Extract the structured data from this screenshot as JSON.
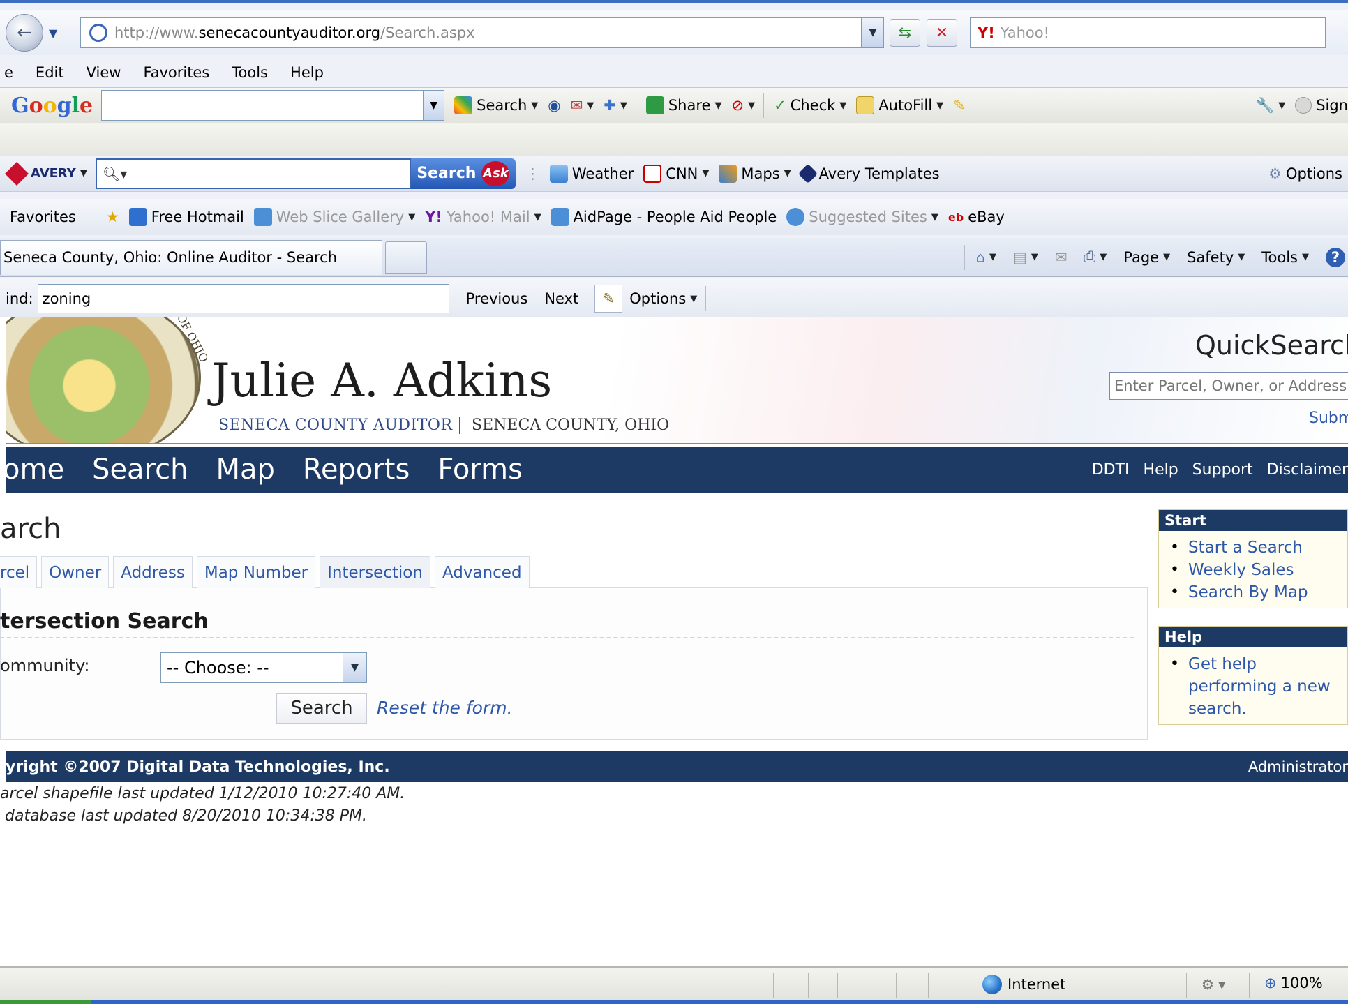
{
  "browser": {
    "address": {
      "host_prefix": "http://www.",
      "host": "senecacountyauditor.org",
      "path": "/Search.aspx"
    },
    "yahoo_search": {
      "brand": "Y!",
      "placeholder": "Yahoo!"
    },
    "menu": [
      "e",
      "Edit",
      "View",
      "Favorites",
      "Tools",
      "Help"
    ],
    "google_toolbar": {
      "logo": [
        "G",
        "o",
        "o",
        "g",
        "l",
        "e"
      ],
      "items": {
        "search": "Search",
        "share": "Share",
        "check": "Check",
        "autofill": "AutoFill",
        "sign": "Sign"
      }
    },
    "ask_toolbar": {
      "brand": "AVERY",
      "search_button": "Search",
      "ask_logo": "Ask",
      "items": {
        "weather": "Weather",
        "cnn": "CNN",
        "maps": "Maps",
        "avery_templates": "Avery Templates",
        "options": "Options"
      }
    },
    "favorites_bar": {
      "label": "Favorites",
      "items": {
        "hotmail": "Free Hotmail",
        "webslice": "Web Slice Gallery",
        "yahoo_mail": "Yahoo! Mail",
        "aidpage": "AidPage - People Aid People",
        "suggested": "Suggested Sites",
        "ebay": "eBay"
      }
    },
    "tab_title": "Seneca County, Ohio: Online Auditor - Search",
    "command_bar": {
      "page": "Page",
      "safety": "Safety",
      "tools": "Tools"
    },
    "find_bar": {
      "label": "ind:",
      "value": "zoning",
      "previous": "Previous",
      "next": "Next",
      "options": "Options"
    },
    "status": {
      "zone": "Internet",
      "zoom": "100%"
    }
  },
  "page": {
    "banner": {
      "seal_text": "OF OHIO",
      "name": "Julie A. Adkins",
      "subtitle_left": "SENECA COUNTY AUDITOR",
      "subtitle_right": "SENECA COUNTY, OHIO",
      "quicksearch_title": "QuickSearch",
      "quicksearch_placeholder": "Enter Parcel, Owner, or Address",
      "quicksearch_submit": "Submit"
    },
    "nav": {
      "main": [
        "ome",
        "Search",
        "Map",
        "Reports",
        "Forms"
      ],
      "right": [
        "DDTI",
        "Help",
        "Support",
        "Disclaimer"
      ]
    },
    "title": "arch",
    "tabs": [
      "rcel",
      "Owner",
      "Address",
      "Map Number",
      "Intersection",
      "Advanced"
    ],
    "form": {
      "heading": "tersection Search",
      "community_label": "ommunity:",
      "community_value": "-- Choose: --",
      "search_button": "Search",
      "reset_link": "Reset the form."
    },
    "sidebar": {
      "start": {
        "title": "Start",
        "items": [
          "Start a Search",
          "Weekly Sales",
          "Search By Map"
        ]
      },
      "help": {
        "title": "Help",
        "items": [
          "Get help performing a new search."
        ]
      }
    },
    "footer": {
      "copyright": "yright ©2007 Digital Data Technologies, Inc.",
      "admin": "Administrator",
      "updates": [
        "arcel shapefile last updated 1/12/2010 10:27:40 AM.",
        " database last updated 8/20/2010 10:34:38 PM."
      ]
    }
  }
}
